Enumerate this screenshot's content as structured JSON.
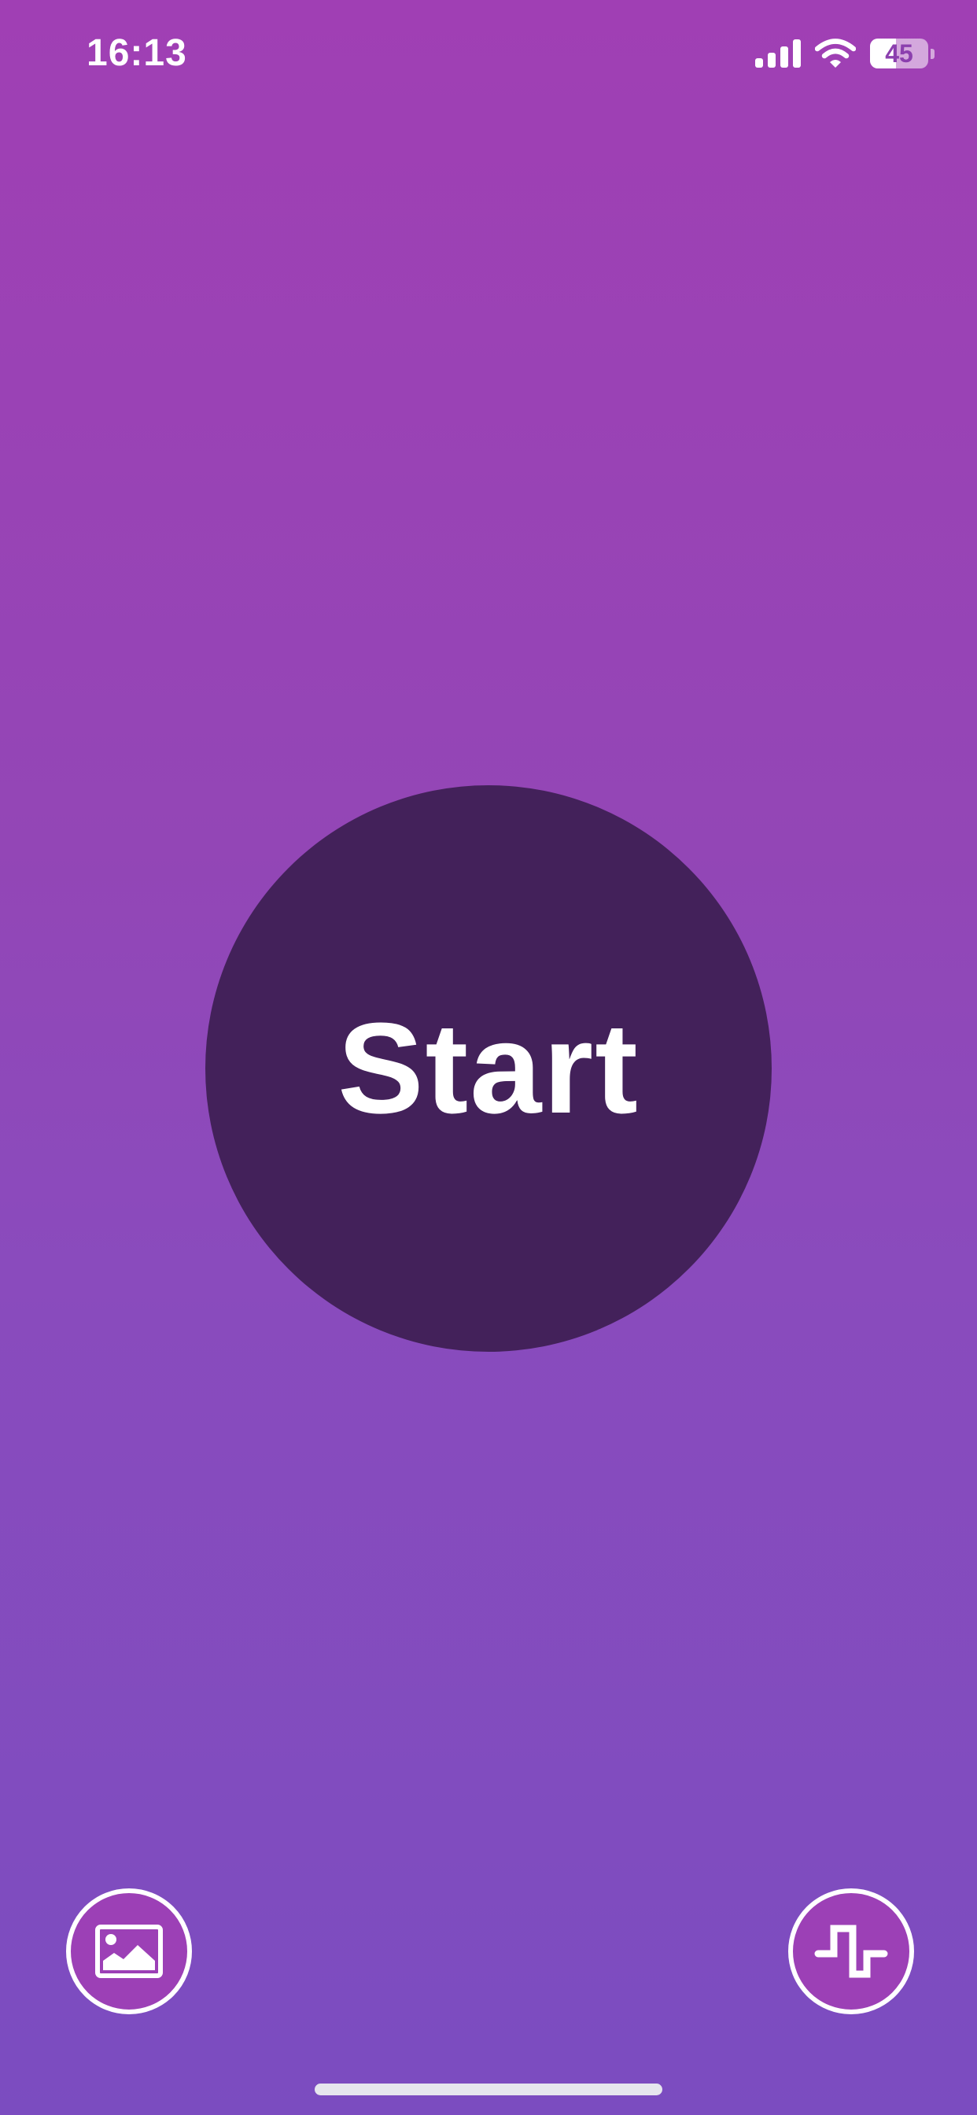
{
  "status_bar": {
    "time": "16:13",
    "battery_level": "45",
    "battery_fraction": 0.45,
    "icons": [
      "cellular-signal-icon",
      "wifi-icon",
      "battery-icon"
    ]
  },
  "main": {
    "start_label": "Start"
  },
  "bottom_controls": {
    "left_icon": "image-gallery-icon",
    "right_icon": "square-wave-icon"
  },
  "colors": {
    "background_top": "#a03fb4",
    "background_bottom": "#7b4cc0",
    "start_button": "#43215a",
    "control_fill": "#9c40b6",
    "foreground": "#ffffff"
  }
}
